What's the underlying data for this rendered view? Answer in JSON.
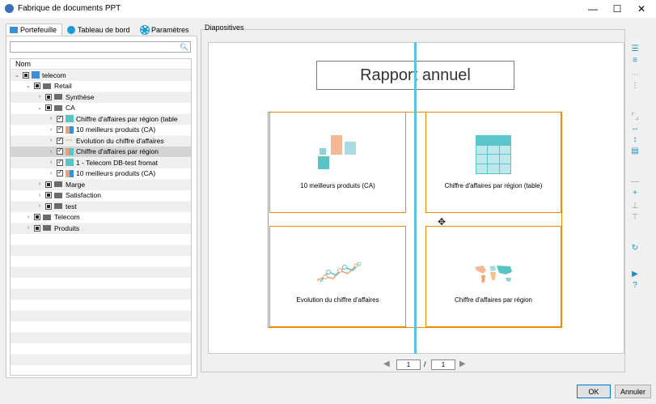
{
  "window": {
    "title": "Fabrique de documents PPT",
    "minimize_glyph": "—",
    "maximize_glyph": "☐",
    "close_glyph": "✕"
  },
  "tabs": [
    "Portefeuille",
    "Tableau de bord",
    "Paramètres"
  ],
  "search": {
    "value": "",
    "placeholder": ""
  },
  "tree": {
    "header": "Nom",
    "rows": [
      {
        "label": "telecom"
      },
      {
        "label": "Retail"
      },
      {
        "label": "Synthèse"
      },
      {
        "label": "CA"
      },
      {
        "label": "Chiffre d'affaires par région (table"
      },
      {
        "label": "10 meilleurs produits (CA)"
      },
      {
        "label": "Evolution du chiffre d'affaires"
      },
      {
        "label": "Chiffre d'affaires par région"
      },
      {
        "label": "1 - Telecom DB-test fromat"
      },
      {
        "label": "10 meilleurs produits (CA)"
      },
      {
        "label": "Marge"
      },
      {
        "label": "Satisfaction"
      },
      {
        "label": "test"
      },
      {
        "label": "Telecom"
      },
      {
        "label": "Produits"
      }
    ]
  },
  "slides": {
    "section_label": "Diapositives",
    "slide_title": "Rapport annuel",
    "cells": [
      "10 meilleurs produits (CA)",
      "Chiffre d'affaires par région (table)",
      "Evolution du chiffre d'affaires",
      "Chiffre d'affaires par région"
    ]
  },
  "pager": {
    "current": "1",
    "separator": "/",
    "total": "1"
  },
  "buttons": {
    "ok": "OK",
    "cancel": "Annuler"
  },
  "colors": {
    "accent": "#1a8fd0",
    "frame_orange": "#f08a00",
    "guide_line": "#58c4e0"
  }
}
